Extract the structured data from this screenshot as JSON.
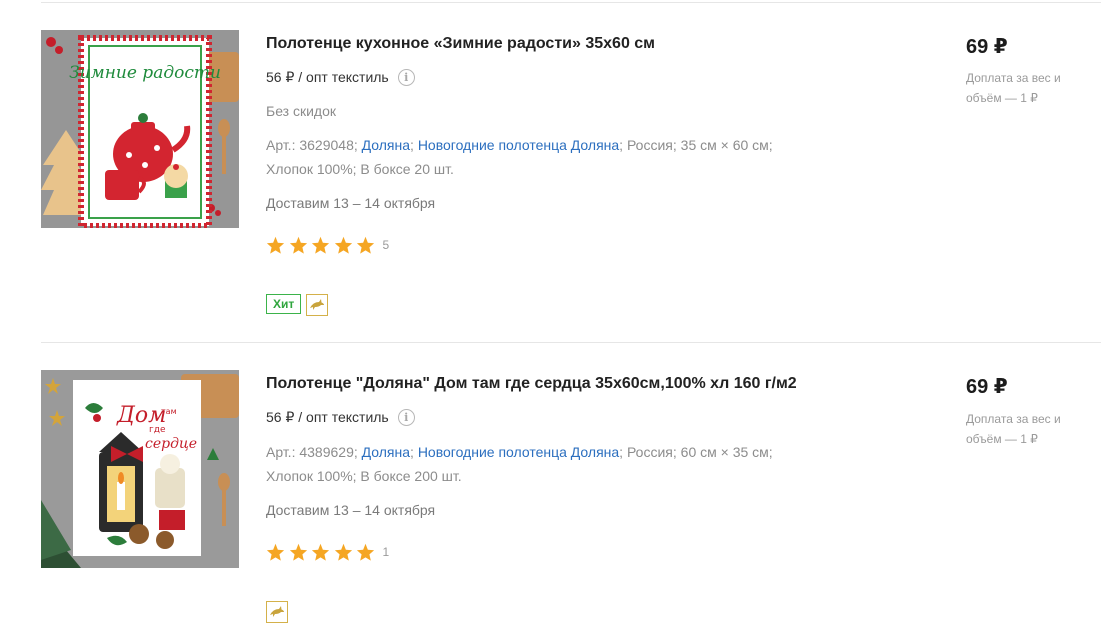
{
  "products": [
    {
      "title": "Полотенце кухонное «Зимние радости» 35х60 см",
      "wholesale_price": "56 ₽ / опт текстиль",
      "discount_note": "Без скидок",
      "article": "Арт.: 3629048;",
      "brand": "Доляна",
      "collection": "Новогодние полотенца Доляна",
      "country": "Россия;",
      "size": "35 см × 60 см;",
      "material": "Хлопок 100%;",
      "box": "В боксе 20 шт.",
      "delivery": "Доставим 13 – 14 октября",
      "rating": 5,
      "reviews_count": "5",
      "badge_hit": "Хит",
      "price": "69 ₽",
      "surcharge": "Доплата за вес и объём — 1 ₽",
      "image_text": "Зимние радости"
    },
    {
      "title": "Полотенце \"Доляна\" Дом там где сердца 35х60см,100% хл 160 г/м2",
      "wholesale_price": "56 ₽ / опт текстиль",
      "article": "Арт.: 4389629;",
      "brand": "Доляна",
      "collection": "Новогодние полотенца Доляна",
      "country": "Россия;",
      "size": "60 см × 35 см;",
      "material": "Хлопок 100%;",
      "box": "В боксе 200 шт.",
      "delivery": "Доставим 13 – 14 октября",
      "rating": 5,
      "reviews_count": "1",
      "price": "69 ₽",
      "surcharge": "Доплата за вес и объём — 1 ₽",
      "image_text_1": "Дом",
      "image_text_2": "там",
      "image_text_3": "где",
      "image_text_4": "сердце"
    }
  ],
  "colors": {
    "link": "#2c6fbf",
    "star": "#f5a623",
    "badge_green": "#3bb34a",
    "badge_gold": "#d4b14a"
  },
  "icons": {
    "info": "info-icon",
    "star": "star-icon",
    "promo": "dolphin-icon"
  }
}
